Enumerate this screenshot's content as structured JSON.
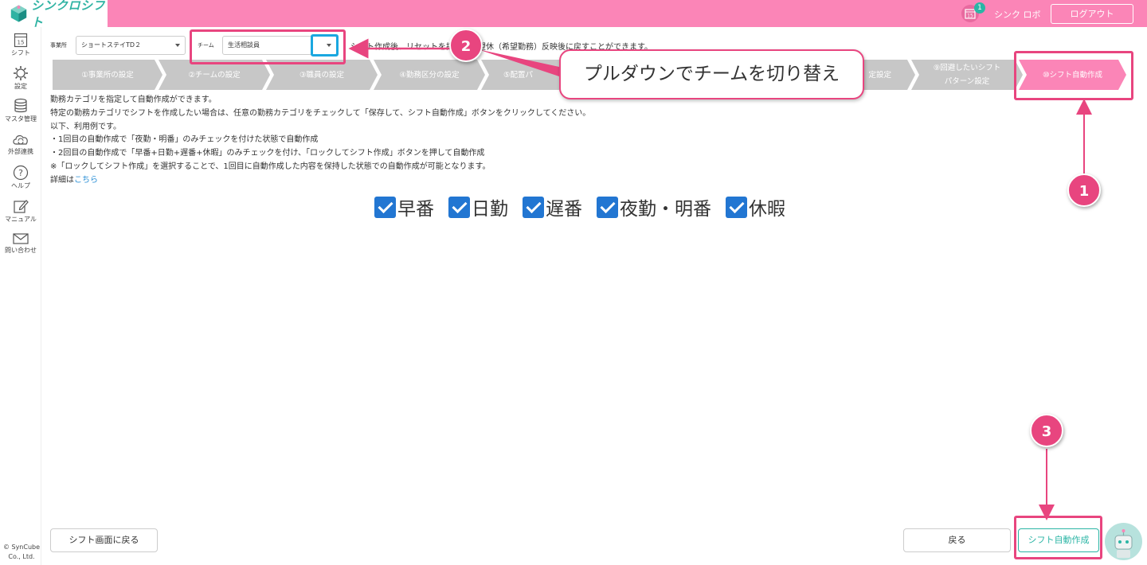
{
  "header": {
    "logo_text": "シンクロシフト",
    "notification_count": "1",
    "calendar_day": "15",
    "user_name": "シンク ロボ",
    "logout_label": "ログアウト"
  },
  "sidebar": {
    "items": [
      {
        "label": "シフト",
        "icon": "calendar-icon",
        "day": "15"
      },
      {
        "label": "設定",
        "icon": "gear-icon"
      },
      {
        "label": "マスタ管理",
        "icon": "database-icon"
      },
      {
        "label": "外部連携",
        "icon": "cloud-sync-icon"
      },
      {
        "label": "ヘルプ",
        "icon": "help-icon"
      },
      {
        "label": "マニュアル",
        "icon": "pencil-icon"
      },
      {
        "label": "問い合わせ",
        "icon": "mail-icon"
      }
    ],
    "copyright_line1": "© SynCube",
    "copyright_line2": "Co., Ltd."
  },
  "form": {
    "office_label": "事業所",
    "office_value": "ショートステイTD２",
    "team_label": "チーム",
    "team_value": "生活相談員",
    "info_part1": "シフト作成後、リセットを押すと",
    "info_part2": "希望休（希望勤務）反映後に戻すことができます。"
  },
  "steps": [
    {
      "label": "①事業所の設定"
    },
    {
      "label": "②チームの設定"
    },
    {
      "label": "③職員の設定"
    },
    {
      "label": "④勤務区分の設定"
    },
    {
      "label": "⑤配置パ"
    },
    {
      "label": ""
    },
    {
      "label": ""
    },
    {
      "label": "定設定"
    },
    {
      "label_line1": "⑨回避したいシフト",
      "label_line2": "パターン設定"
    },
    {
      "label": "⑩シフト自動作成"
    }
  ],
  "description": {
    "lines": [
      "勤務カテゴリを指定して自動作成ができます。",
      "特定の勤務カテゴリでシフトを作成したい場合は、任意の勤務カテゴリをチェックして「保存して、シフト自動作成」ボタンをクリックしてください。",
      "以下、利用例です。",
      "・1回目の自動作成で「夜勤・明番」のみチェックを付けた状態で自動作成",
      "・2回目の自動作成で「早番+日勤+遅番+休暇」のみチェックを付け、「ロックしてシフト作成」ボタンを押して自動作成",
      "※「ロックしてシフト作成」を選択することで、1回目に自動作成した内容を保持した状態での自動作成が可能となります。"
    ],
    "details_prefix": "詳細は",
    "details_link": "こちら"
  },
  "categories": [
    {
      "label": "早番",
      "checked": true
    },
    {
      "label": "日勤",
      "checked": true
    },
    {
      "label": "遅番",
      "checked": true
    },
    {
      "label": "夜勤・明番",
      "checked": true
    },
    {
      "label": "休暇",
      "checked": true
    }
  ],
  "buttons": {
    "back_to_shift": "シフト画面に戻る",
    "back": "戻る",
    "auto_create": "シフト自動作成"
  },
  "annotations": {
    "callout_text": "プルダウンでチームを切り替え",
    "marker1": "1",
    "marker2": "2",
    "marker3": "3",
    "accent_color": "#e8457f",
    "highlight_color": "#1aa7e0"
  },
  "colors": {
    "header_bg": "#fb85b7",
    "brand_teal": "#2bb5a5",
    "checkbox_blue": "#2276d2",
    "step_inactive": "#c7c7c7"
  }
}
